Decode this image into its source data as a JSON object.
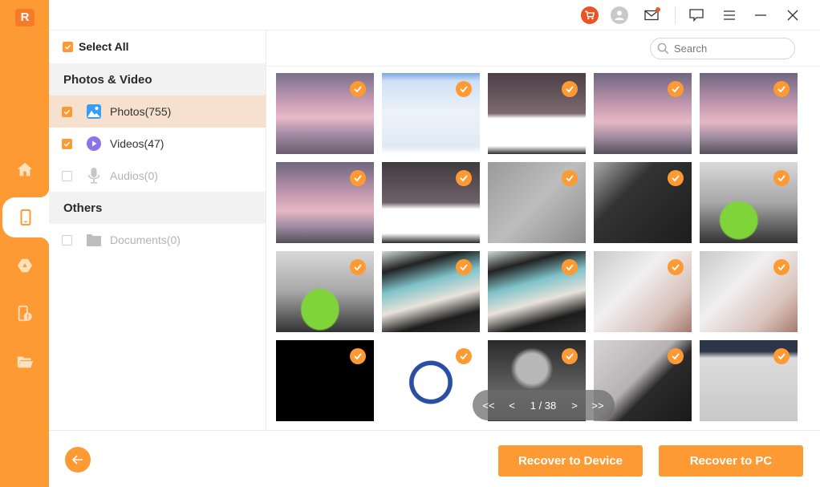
{
  "app": {
    "logo_letter": "R",
    "accent_color": "#fd9a34"
  },
  "rail": {
    "items": [
      {
        "icon": "home-icon",
        "label": "Home"
      },
      {
        "icon": "phone-icon",
        "label": "Device",
        "active": true
      },
      {
        "icon": "cloud-drive-icon",
        "label": "Cloud"
      },
      {
        "icon": "device-warning-icon",
        "label": "Repair"
      },
      {
        "icon": "folder-icon",
        "label": "Files"
      }
    ]
  },
  "topbar": {
    "icons": [
      "cart-icon",
      "user-icon",
      "mail-icon",
      "feedback-icon",
      "menu-icon",
      "minimize-icon",
      "close-icon"
    ]
  },
  "categories": {
    "select_all": {
      "label": "Select All",
      "checked": true
    },
    "sections": [
      {
        "title": "Photos & Video",
        "items": [
          {
            "label": "Photos(755)",
            "icon": "photo-icon",
            "checked": true,
            "selected": true,
            "enabled": true
          },
          {
            "label": "Videos(47)",
            "icon": "video-icon",
            "checked": true,
            "selected": false,
            "enabled": true
          },
          {
            "label": "Audios(0)",
            "icon": "microphone-icon",
            "checked": false,
            "selected": false,
            "enabled": false
          }
        ]
      },
      {
        "title": "Others",
        "items": [
          {
            "label": "Documents(0)",
            "icon": "folder-icon",
            "checked": false,
            "selected": false,
            "enabled": false
          }
        ]
      }
    ]
  },
  "search": {
    "placeholder": "Search",
    "value": ""
  },
  "thumbnails": [
    {
      "desc": "phone home screen with pagoda wallpaper",
      "checked": true
    },
    {
      "desc": "phone dialer screenshot",
      "checked": true
    },
    {
      "desc": "home screen with Gmail prompt",
      "checked": true
    },
    {
      "desc": "phone home screen with pagoda wallpaper",
      "checked": true
    },
    {
      "desc": "phone home screen with pagoda wallpaper",
      "checked": true
    },
    {
      "desc": "phone home screen with pagoda wallpaper",
      "checked": true
    },
    {
      "desc": "home screen with Gmail prompt",
      "checked": true
    },
    {
      "desc": "grey mouse surface",
      "checked": true
    },
    {
      "desc": "black keyboard close-up",
      "checked": true
    },
    {
      "desc": "green ball in office",
      "checked": true
    },
    {
      "desc": "green ball in office",
      "checked": true
    },
    {
      "desc": "teal box on shelf",
      "checked": true
    },
    {
      "desc": "teal box on shelf",
      "checked": true
    },
    {
      "desc": "hand holding white paper",
      "checked": true
    },
    {
      "desc": "hand holding white paper",
      "checked": true
    },
    {
      "desc": "black video frame",
      "checked": true
    },
    {
      "desc": "blue alarm clock",
      "checked": true
    },
    {
      "desc": "black and white girl smiling",
      "checked": true
    },
    {
      "desc": "ceiling tiles",
      "checked": true
    },
    {
      "desc": "ceiling tiles",
      "checked": true
    }
  ],
  "pager": {
    "first": "<<",
    "prev": "<",
    "page_text": "1 / 38",
    "current_page": 1,
    "total_pages": 38,
    "next": ">",
    "last": ">>"
  },
  "actions": {
    "recover_device": "Recover to Device",
    "recover_pc": "Recover to PC"
  }
}
